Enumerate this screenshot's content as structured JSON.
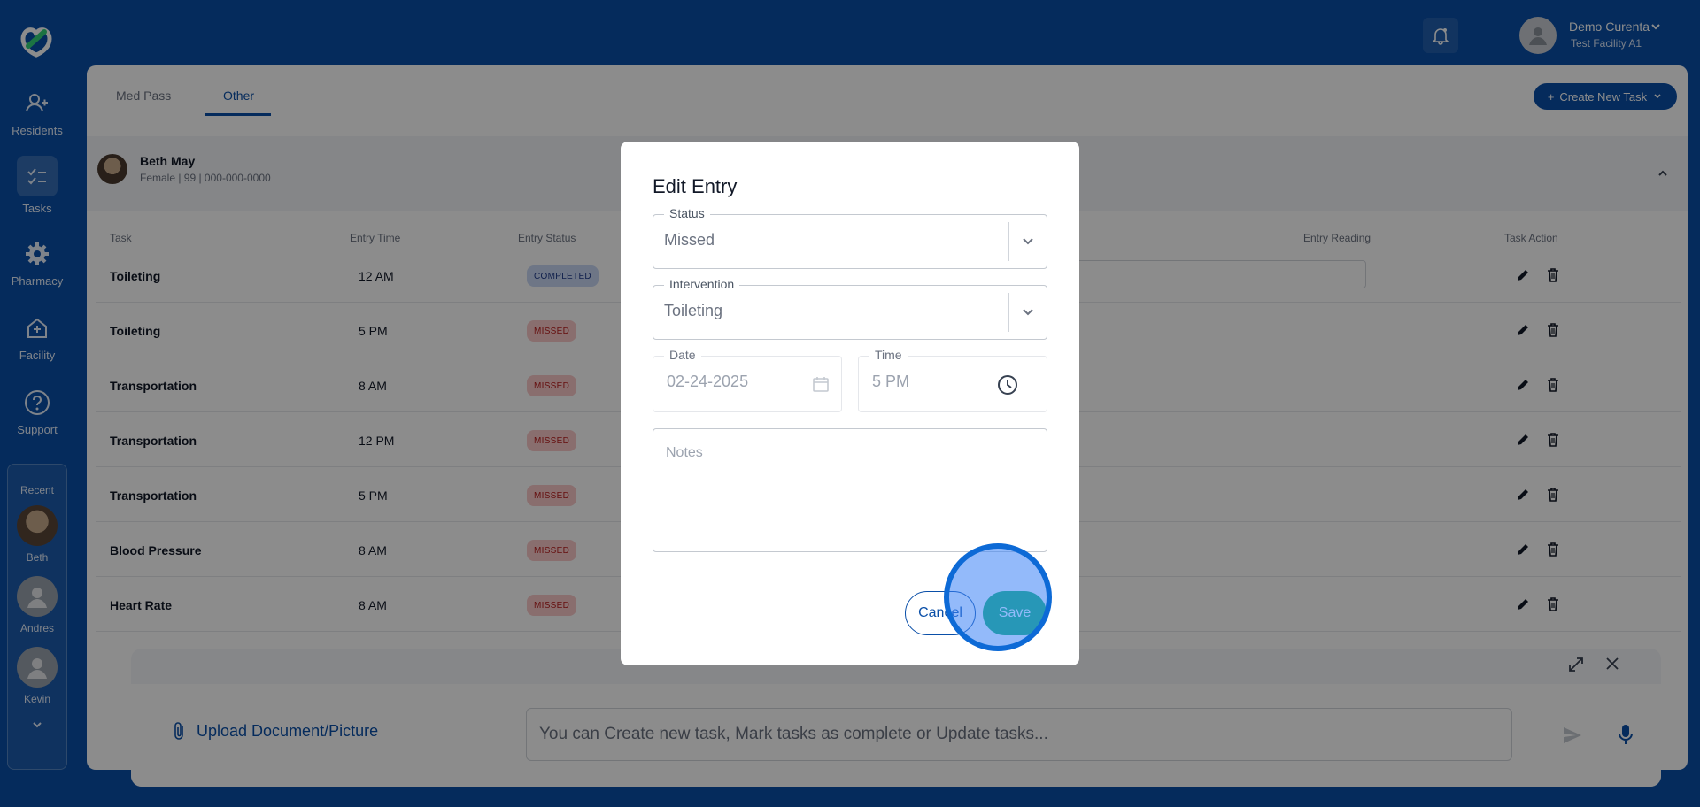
{
  "sidebar": {
    "logo_icon": "curenta-logo-icon",
    "items": [
      {
        "label": "Residents",
        "icon": "residents-icon"
      },
      {
        "label": "Tasks",
        "icon": "tasks-icon"
      },
      {
        "label": "Pharmacy",
        "icon": "gear-icon"
      },
      {
        "label": "Facility",
        "icon": "facility-icon"
      },
      {
        "label": "Support",
        "icon": "help-icon"
      }
    ],
    "recent": {
      "title": "Recent",
      "people": [
        "Beth",
        "Andres",
        "Kevin"
      ]
    }
  },
  "topbar": {
    "user_name": "Demo Curenta",
    "facility": "Test Facility A1"
  },
  "main": {
    "tabs": [
      {
        "label": "Med Pass"
      },
      {
        "label": "Other"
      }
    ],
    "active_tab": "Other",
    "create_button": "Create New Task",
    "resident": {
      "name": "Beth May",
      "info": "Female | 99 | 000-000-0000"
    },
    "table": {
      "headers": {
        "task": "Task",
        "entry_time": "Entry Time",
        "entry_status": "Entry Status",
        "entry_reading": "Entry Reading",
        "task_action": "Task Action"
      },
      "rows": [
        {
          "task": "Toileting",
          "time": "12 AM",
          "status": "COMPLETED"
        },
        {
          "task": "Toileting",
          "time": "5 PM",
          "status": "MISSED"
        },
        {
          "task": "Transportation",
          "time": "8 AM",
          "status": "MISSED"
        },
        {
          "task": "Transportation",
          "time": "12 PM",
          "status": "MISSED"
        },
        {
          "task": "Transportation",
          "time": "5 PM",
          "status": "MISSED"
        },
        {
          "task": "Blood Pressure",
          "time": "8 AM",
          "status": "MISSED"
        },
        {
          "task": "Heart Rate",
          "time": "8 AM",
          "status": "MISSED"
        }
      ]
    }
  },
  "chat": {
    "upload_label": "Upload Document/Picture",
    "input_placeholder": "You can Create new task, Mark tasks as complete or Update tasks..."
  },
  "modal": {
    "title": "Edit Entry",
    "status": {
      "label": "Status",
      "value": "Missed"
    },
    "intervention": {
      "label": "Intervention",
      "value": "Toileting"
    },
    "date": {
      "label": "Date",
      "value": "02-24-2025"
    },
    "time": {
      "label": "Time",
      "value": "5 PM"
    },
    "notes_placeholder": "Notes",
    "cancel_label": "Cancel",
    "save_label": "Save"
  },
  "colors": {
    "brand": "#0a4fa8",
    "save": "#10b26c",
    "missed_badge": "#f9c8c8",
    "completed_badge": "#c9d8f5"
  }
}
